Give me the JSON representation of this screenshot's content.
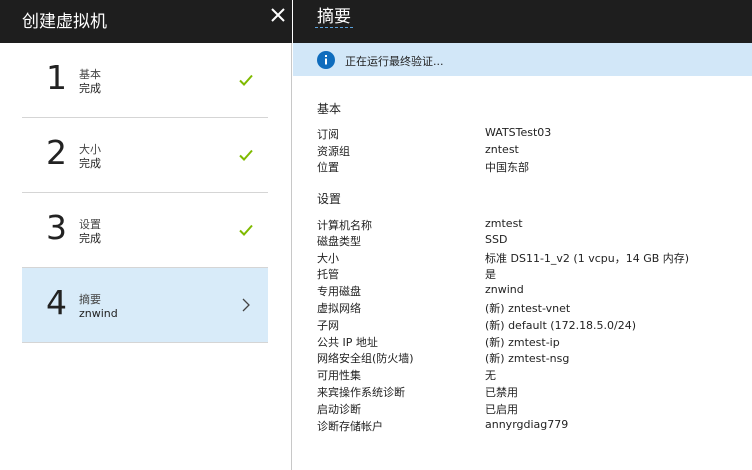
{
  "left": {
    "title": "创建虚拟机",
    "steps": [
      {
        "number": "1",
        "title": "基本",
        "subtitle": "完成",
        "status": "check-icon"
      },
      {
        "number": "2",
        "title": "大小",
        "subtitle": "完成",
        "status": "check-icon"
      },
      {
        "number": "3",
        "title": "设置",
        "subtitle": "完成",
        "status": "check-icon"
      },
      {
        "number": "4",
        "title": "摘要",
        "subtitle": "znwind",
        "status": "chevron-right-icon"
      }
    ]
  },
  "right": {
    "title": "摘要",
    "banner": {
      "icon": "info-icon",
      "text": "正在运行最终验证..."
    },
    "sections": [
      {
        "title": "基本",
        "rows": [
          {
            "key": "订阅",
            "value": "WATSTest03"
          },
          {
            "key": "资源组",
            "value": "zntest"
          },
          {
            "key": "位置",
            "value": "中国东部"
          }
        ]
      },
      {
        "title": "设置",
        "rows": [
          {
            "key": "计算机名称",
            "value": "zmtest"
          },
          {
            "key": "磁盘类型",
            "value": "SSD"
          },
          {
            "key": "大小",
            "value": "标准 DS11-1_v2 (1 vcpu，14 GB 内存)"
          },
          {
            "key": "托管",
            "value": "是"
          },
          {
            "key": "专用磁盘",
            "value": "znwind"
          },
          {
            "key": "虚拟网络",
            "value": "(新) zntest-vnet"
          },
          {
            "key": "子网",
            "value": "(新) default (172.18.5.0/24)"
          },
          {
            "key": "公共 IP 地址",
            "value": "(新) zmtest-ip"
          },
          {
            "key": "网络安全组(防火墙)",
            "value": "(新) zmtest-nsg"
          },
          {
            "key": "可用性集",
            "value": "无"
          },
          {
            "key": "来宾操作系统诊断",
            "value": "已禁用"
          },
          {
            "key": "启动诊断",
            "value": "已启用"
          },
          {
            "key": "诊断存储帐户",
            "value": "annyrgdiag779"
          }
        ]
      }
    ]
  },
  "colors": {
    "header": "#1e1e1e",
    "active_step": "#d8ebf9",
    "banner": "#d2e7f8",
    "check": "#7fba00",
    "info": "#0f6cbd"
  }
}
